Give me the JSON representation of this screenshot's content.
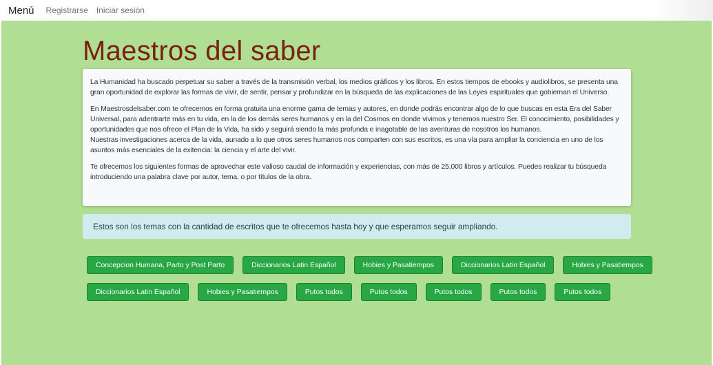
{
  "nav": {
    "brand": "Menú",
    "links": [
      "Registrarse",
      "Iniciar sesión"
    ]
  },
  "main": {
    "title": "Maestros del saber",
    "paragraphs": [
      "La Humanidad ha buscado perpetuar su saber a través de la transmisión verbal, los medios gráficos y los libros. En estos tiempos de ebooks y audiolibros, se presenta una gran oportunidad de explorar las formas de vivir, de sentir, pensar y profundizar en la búsqueda de las explicaciones de las Leyes espirituales que gobiernan el Universo.",
      "En Maestrosdelsaber.com te ofrecemos en forma gratuita una enorme gama de temas y autores, en donde podrás encontrar algo de lo que buscas en esta Era del Saber Universal, para adentrarte más en tu vida, en la de los demás seres humanos y en la del Cosmos en donde vivimos y tenemos nuestro Ser. El conocimiento, posibilidades y oportunidades que nos ofrece el Plan de la Vida, ha sido y seguirá siendo la más profunda e inagotable de las aventuras de nosotros los humanos.",
      "Nuestras investigaciones acerca de la vida, aunado a lo que otros seres humanos nos comparten con sus escritos, es una vía para ampliar la conciencia en uno de los asuntos más esenciales de la exitencia: la ciencia y el arte del vivir.",
      "Te ofrecemos los siguientes formas de aprovechar este valioso caudal de información y experiencias, con más de 25,000 libros y artículos. Puedes realizar tu búsqueda introduciendo una palabra clave por autor, tema, o por títulos de la obra."
    ],
    "alert": "Estos son los temas con la cantidad de escritos que te ofrecemos hasta hoy y que esperamos seguir ampliando.",
    "tags_row1": [
      "Concepcion Humana, Parto y Post Parto",
      "Diccionarios Latin Español",
      "Hobies y Pasatiempos",
      "Diccionarios Latin Español",
      "Hobies y Pasatiempos"
    ],
    "tags_row2": [
      "Diccionarios Latin Español",
      "Hobies y Pasatiempos",
      "Putos todos",
      "Putos todos",
      "Putos todos",
      "Putos todos",
      "Putos todos"
    ]
  },
  "colors": {
    "page_background": "#b0df94",
    "title": "#7b1e14",
    "tag_button": "#28a745",
    "alert_background": "#d1ebee"
  }
}
